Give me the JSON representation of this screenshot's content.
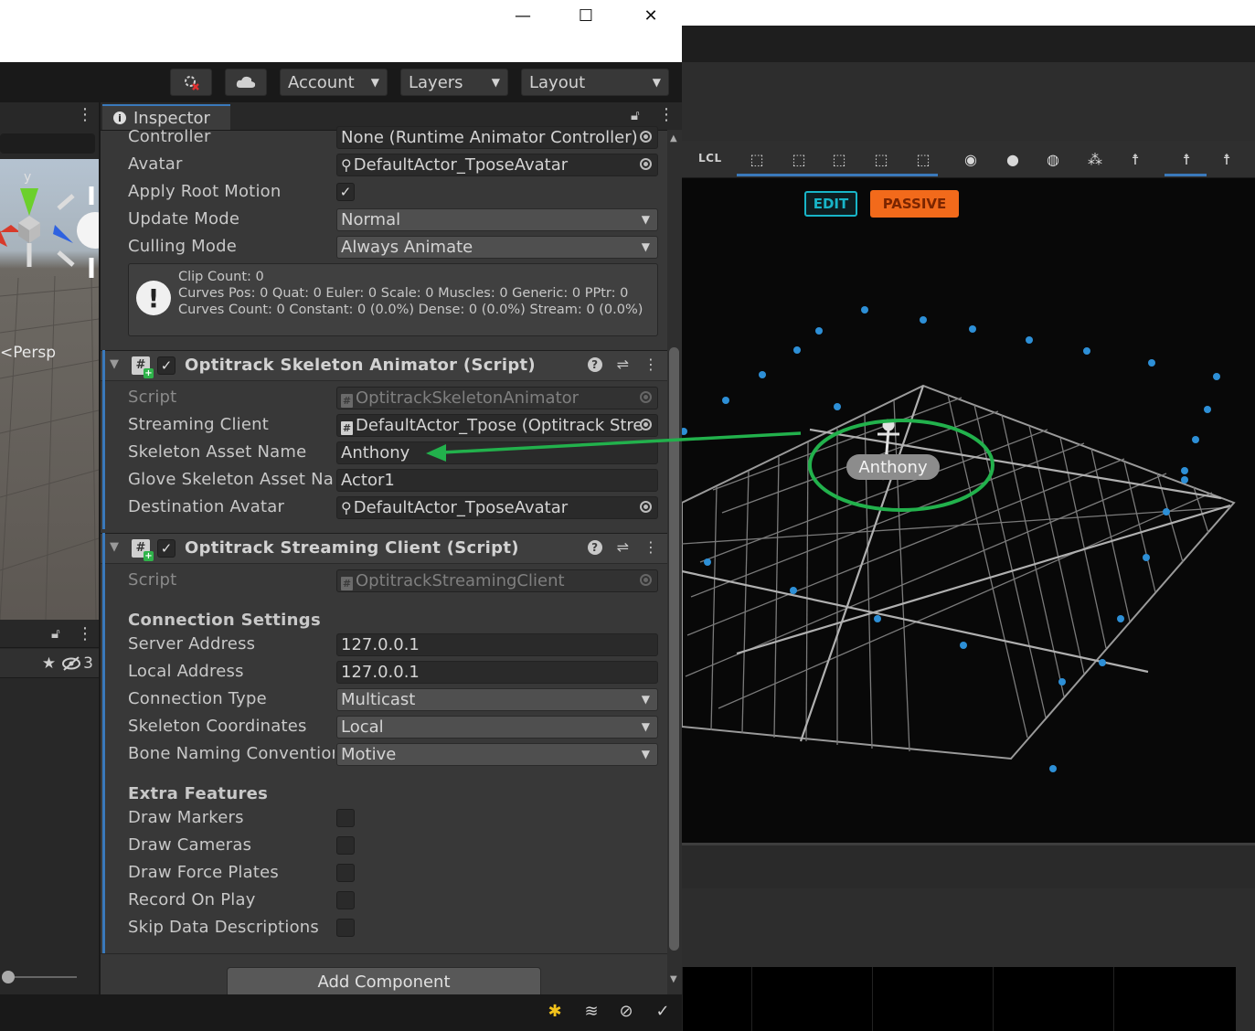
{
  "window": {
    "minimize_glyph": "—",
    "maximize_glyph": "☐",
    "close_glyph": "✕"
  },
  "toolbar": {
    "account_label": "Account",
    "layers_label": "Layers",
    "layout_label": "Layout",
    "dropdown_glyph": "▼"
  },
  "scene": {
    "axis_y": "y",
    "persp_label": "Persp",
    "visibility_count": "3"
  },
  "inspector": {
    "tab_label": "Inspector",
    "animator": {
      "controller_label": "Controller",
      "controller_value": "None (Runtime Animator Controller)",
      "avatar_label": "Avatar",
      "avatar_value": "DefaultActor_TposeAvatar",
      "apply_root_motion_label": "Apply Root Motion",
      "apply_root_motion_checked": "✓",
      "update_mode_label": "Update Mode",
      "update_mode_value": "Normal",
      "culling_mode_label": "Culling Mode",
      "culling_mode_value": "Always Animate",
      "help_lines": [
        "Clip Count: 0",
        "Curves Pos: 0 Quat: 0 Euler: 0 Scale: 0 Muscles: 0 Generic: 0 PPtr: 0",
        "Curves Count: 0 Constant: 0 (0.0%) Dense: 0 (0.0%) Stream: 0 (0.0%)"
      ]
    },
    "skeleton_animator": {
      "title": "Optitrack Skeleton Animator (Script)",
      "enabled_mark": "✓",
      "script_label": "Script",
      "script_value": "OptitrackSkeletonAnimator",
      "streaming_client_label": "Streaming Client",
      "streaming_client_value": "DefaultActor_Tpose (Optitrack Stre",
      "skeleton_asset_name_label": "Skeleton Asset Name",
      "skeleton_asset_name_value": "Anthony",
      "glove_skeleton_label": "Glove Skeleton Asset Nan",
      "glove_skeleton_value": "Actor1",
      "destination_avatar_label": "Destination Avatar",
      "destination_avatar_value": "DefaultActor_TposeAvatar"
    },
    "streaming_client": {
      "title": "Optitrack Streaming Client (Script)",
      "enabled_mark": "✓",
      "script_label": "Script",
      "script_value": "OptitrackStreamingClient",
      "connection_settings_title": "Connection Settings",
      "server_address_label": "Server Address",
      "server_address_value": "127.0.0.1",
      "local_address_label": "Local Address",
      "local_address_value": "127.0.0.1",
      "connection_type_label": "Connection Type",
      "connection_type_value": "Multicast",
      "skeleton_coordinates_label": "Skeleton Coordinates",
      "skeleton_coordinates_value": "Local",
      "bone_naming_label": "Bone Naming Convention",
      "bone_naming_value": "Motive",
      "extra_features_title": "Extra Features",
      "draw_markers_label": "Draw Markers",
      "draw_cameras_label": "Draw Cameras",
      "draw_force_plates_label": "Draw Force Plates",
      "record_on_play_label": "Record On Play",
      "skip_data_descriptions_label": "Skip Data Descriptions"
    },
    "add_component_label": "Add Component"
  },
  "motive": {
    "lcl_label": "LCL",
    "edit_label": "EDIT",
    "passive_label": "PASSIVE",
    "skeleton_label": "Anthony",
    "annotation_color": "#22b14c",
    "marker_color": "#2d8fd6"
  }
}
